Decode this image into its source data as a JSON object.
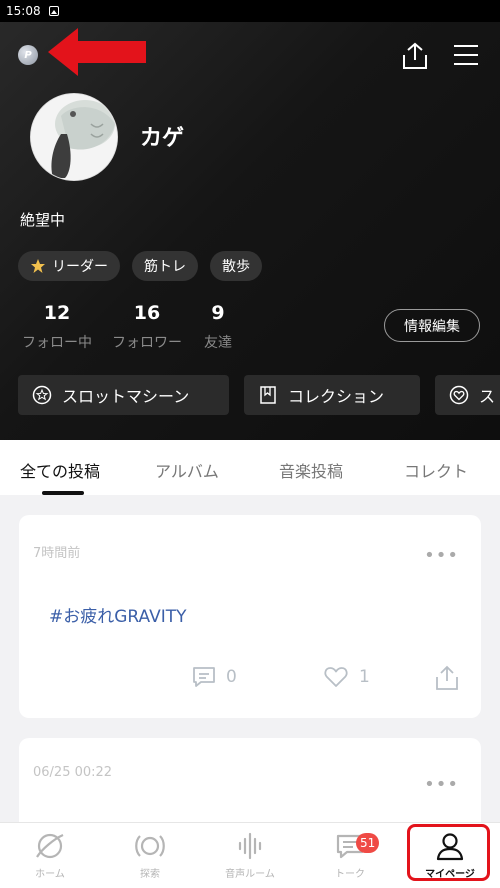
{
  "status_bar": {
    "time": "15:08"
  },
  "header": {
    "username": "カゲ",
    "bio": "絶望中",
    "tags": [
      {
        "label": "リーダー",
        "icon": "star-icon"
      },
      {
        "label": "筋トレ"
      },
      {
        "label": "散歩"
      }
    ],
    "stats": [
      {
        "value": "12",
        "label": "フォロー中"
      },
      {
        "value": "16",
        "label": "フォロワー"
      },
      {
        "value": "9",
        "label": "友達"
      }
    ],
    "edit_label": "情報編集",
    "actions": [
      {
        "label": "スロットマシーン",
        "icon": "star-circle-icon"
      },
      {
        "label": "コレクション",
        "icon": "book-icon"
      },
      {
        "label": "ス",
        "icon": "heart-circle-icon"
      }
    ]
  },
  "tabs": [
    "全ての投稿",
    "アルバム",
    "音楽投稿",
    "コレクト"
  ],
  "active_tab": "全ての投稿",
  "posts": [
    {
      "time": "7時間前",
      "text": "#お疲れGRAVITY",
      "comments": "0",
      "likes": "1"
    },
    {
      "time": "06/25 00:22"
    }
  ],
  "bottom_nav": [
    {
      "label": "ホーム",
      "icon": "planet-icon"
    },
    {
      "label": "探索",
      "icon": "explore-icon"
    },
    {
      "label": "音声ルーム",
      "icon": "soundwave-icon"
    },
    {
      "label": "トーク",
      "icon": "chat-icon",
      "badge": "51"
    },
    {
      "label": "マイページ",
      "icon": "person-icon",
      "active": true
    }
  ],
  "colors": {
    "accent_red": "#e3131b",
    "hashtag": "#3b5fa8",
    "badge": "#ef4a45"
  }
}
